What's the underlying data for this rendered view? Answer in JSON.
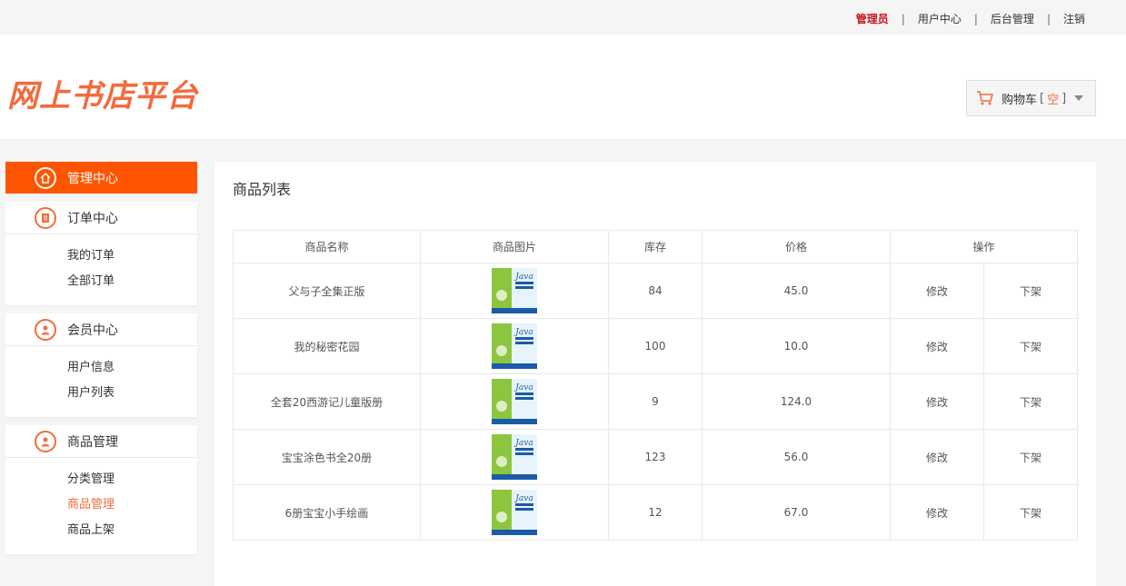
{
  "topbar": {
    "admin": "管理员",
    "user_center": "用户中心",
    "backend": "后台管理",
    "logout": "注销"
  },
  "header": {
    "logo": "网上书店平台",
    "cart_label": "购物车",
    "cart_open": "[",
    "cart_status": "空",
    "cart_close": "]"
  },
  "sidebar": {
    "main": "管理中心",
    "groups": [
      {
        "title": "订单中心",
        "items": [
          "我的订单",
          "全部订单"
        ]
      },
      {
        "title": "会员中心",
        "items": [
          "用户信息",
          "用户列表"
        ]
      },
      {
        "title": "商品管理",
        "items": [
          "分类管理",
          "商品管理",
          "商品上架"
        ]
      }
    ]
  },
  "main": {
    "title": "商品列表",
    "columns": [
      "商品名称",
      "商品图片",
      "库存",
      "价格",
      "操作"
    ],
    "rows": [
      {
        "name": "父与子全集正版",
        "stock": "84",
        "price": "45.0",
        "edit": "修改",
        "off": "下架"
      },
      {
        "name": "我的秘密花园",
        "stock": "100",
        "price": "10.0",
        "edit": "修改",
        "off": "下架"
      },
      {
        "name": "全套20西游记儿童版册",
        "stock": "9",
        "price": "124.0",
        "edit": "修改",
        "off": "下架"
      },
      {
        "name": "宝宝涂色书全20册",
        "stock": "123",
        "price": "56.0",
        "edit": "修改",
        "off": "下架"
      },
      {
        "name": "6册宝宝小手绘画",
        "stock": "12",
        "price": "67.0",
        "edit": "修改",
        "off": "下架"
      }
    ]
  },
  "colors": {
    "accent": "#ff5500",
    "logo": "#f36b3c",
    "admin": "#c8161d"
  }
}
